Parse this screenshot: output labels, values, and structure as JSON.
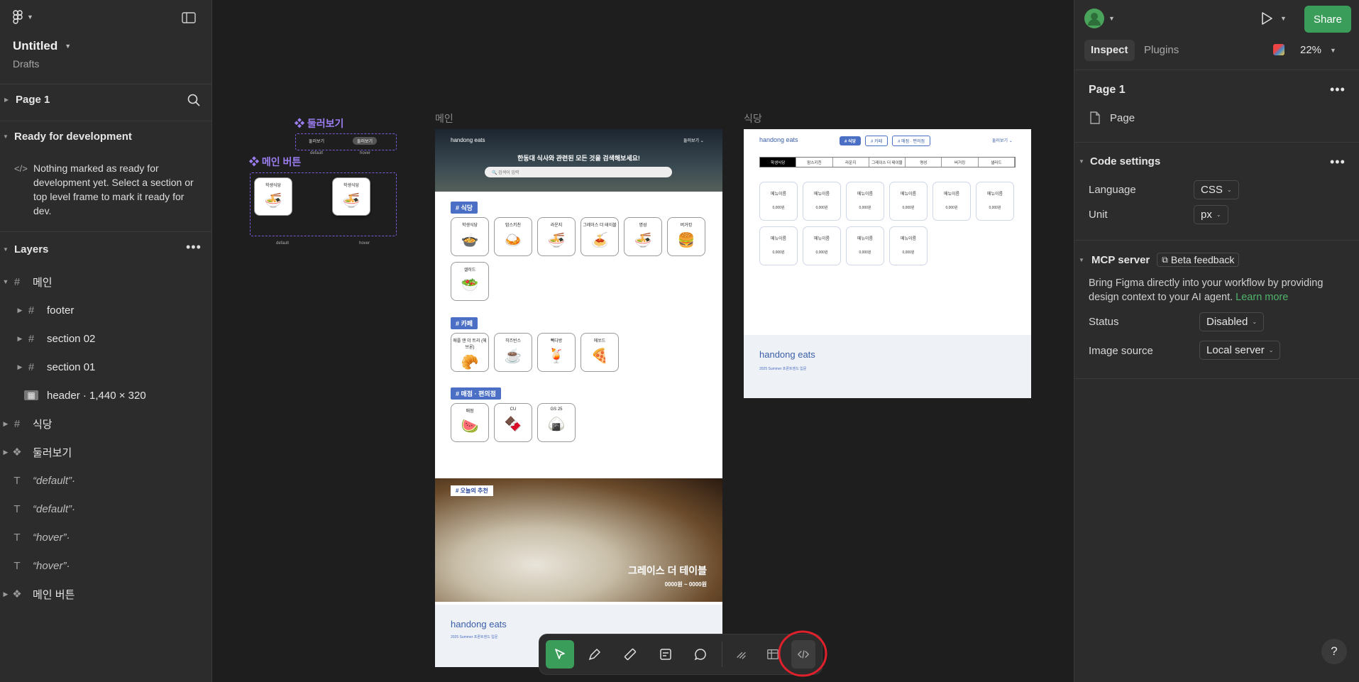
{
  "left": {
    "file_title": "Untitled",
    "file_location": "Drafts",
    "page": "Page 1",
    "ready_header": "Ready for development",
    "ready_text": "Nothing marked as ready for development yet. Select a section or top level frame to mark it ready for dev.",
    "layers_header": "Layers",
    "layers": [
      {
        "name": "메인",
        "icon": "frame-icon",
        "indent": 0
      },
      {
        "name": "footer",
        "icon": "frame-icon",
        "indent": 1
      },
      {
        "name": "section 02",
        "icon": "frame-icon",
        "indent": 1
      },
      {
        "name": "section 01",
        "icon": "frame-icon",
        "indent": 1
      },
      {
        "name": "header · 1,440 × 320",
        "icon": "image-icon",
        "indent": 1
      },
      {
        "name": "식당",
        "icon": "frame-icon",
        "indent": 0
      },
      {
        "name": "둘러보기",
        "icon": "component-icon",
        "indent": 0
      },
      {
        "name": "“default”·",
        "icon": "text-icon",
        "indent": 0,
        "italic": true
      },
      {
        "name": "“default”·",
        "icon": "text-icon",
        "indent": 0,
        "italic": true
      },
      {
        "name": "“hover”·",
        "icon": "text-icon",
        "indent": 0,
        "italic": true
      },
      {
        "name": "“hover”·",
        "icon": "text-icon",
        "indent": 0,
        "italic": true
      },
      {
        "name": "메인 버튼",
        "icon": "component-icon",
        "indent": 0
      }
    ]
  },
  "right": {
    "share_label": "Share",
    "tabs": [
      "Inspect",
      "Plugins"
    ],
    "zoom": "22%",
    "page_title": "Page 1",
    "page_item": "Page",
    "code_settings": "Code settings",
    "language_label": "Language",
    "language_value": "CSS",
    "unit_label": "Unit",
    "unit_value": "px",
    "mcp_label": "MCP server",
    "beta_label": "Beta feedback",
    "mcp_text": "Bring Figma directly into your workflow by providing design context to your AI agent.",
    "learn_more": "Learn more",
    "status_label": "Status",
    "status_value": "Disabled",
    "image_source_label": "Image source",
    "image_source_value": "Local server",
    "help": "?"
  },
  "canvas": {
    "comp_browse_label": "❖ 둘러보기",
    "comp_main_btn_label": "❖ 메인 버튼",
    "browse_btn": "둘러보기",
    "default_label": "default",
    "hover_label": "hover",
    "student_dining": "학생식당",
    "frame_main_label": "메인",
    "frame_diner_label": "식당",
    "brand": "handong eats",
    "nav_browse": "둘러보기",
    "hero_text": "한동대 식사와 관련된 모든 것을 검색해보세요!",
    "search_placeholder": "검색어 입력",
    "sec_dining": "# 식당",
    "dining_items": [
      "학생식당",
      "맘스키친",
      "라운지",
      "그레이스 더 테이블",
      "명성",
      "버거킹",
      "샐러드"
    ],
    "sec_cafe": "# 카페",
    "cafe_items": [
      "애플 앤 더 트리 (헤브론)",
      "히즈빈스",
      "빽다방",
      "에쏘드"
    ],
    "sec_store": "# 매점 · 편의점",
    "store_items": [
      "매점",
      "CU",
      "GS 25"
    ],
    "rec_tag": "# 오늘의 추천",
    "rec_name": "그레이스 더 테이블",
    "rec_price": "0000원 ~ 0000원",
    "footer_brand": "handong eats",
    "footer_sub": "2025 Summer 프론트엔드 입문",
    "diner_tabs": [
      "학생식당",
      "맘스키친",
      "라운지",
      "그레이스 더 테이블",
      "명성",
      "버거킹",
      "샐러드"
    ],
    "diner_chips": [
      "# 식당",
      "# 카페",
      "# 매점 · 편의점"
    ],
    "menu_name": "메뉴이름",
    "menu_price": "0,000원"
  }
}
